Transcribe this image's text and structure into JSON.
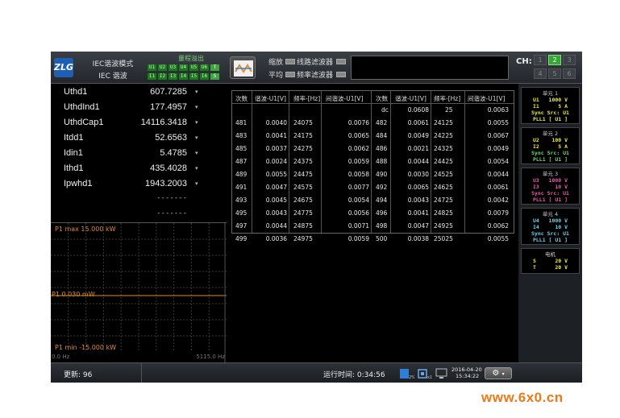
{
  "header": {
    "logo_text": "ZLG",
    "mode_line1": "IEC谐波模式",
    "mode_line2": "IEC 谐波",
    "range_title": "量程溢出",
    "range_row1": [
      "U1",
      "U2",
      "U3",
      "U4",
      "U5",
      "U6",
      "T"
    ],
    "range_row2": [
      "I1",
      "I2",
      "I3",
      "I4",
      "I5",
      "I6",
      "S"
    ],
    "opt_zoom": "缩放",
    "opt_line_filter": "线路滤波器",
    "opt_average": "平均",
    "opt_freq_filter": "频率滤波器",
    "ch_label": "CH:",
    "channels": [
      "1",
      "2",
      "3",
      "4",
      "5",
      "6"
    ],
    "active_channel": "2"
  },
  "measurements": [
    {
      "label": "Uthd1",
      "value": "607.7285"
    },
    {
      "label": "UthdInd1",
      "value": "177.4957"
    },
    {
      "label": "UthdCap1",
      "value": "14116.3418"
    },
    {
      "label": "Itdd1",
      "value": "52.6563"
    },
    {
      "label": "Idin1",
      "value": "5.4785"
    },
    {
      "label": "Ithd1",
      "value": "435.4028"
    },
    {
      "label": "Ipwhd1",
      "value": "1943.2003"
    },
    {
      "label": "",
      "value": "-------"
    },
    {
      "label": "",
      "value": "-------"
    }
  ],
  "harmonic_table": {
    "headers": [
      "次数",
      "谐波-U1[V]",
      "频率-[Hz]",
      "间谐波-U1[V]",
      "次数",
      "谐波-U1[V]",
      "频率-[Hz]",
      "间谐波-U1[V]"
    ],
    "rows": [
      [
        "",
        "",
        "",
        "",
        "dc",
        "0.0608",
        "25",
        "0.0063"
      ],
      [
        "481",
        "0.0040",
        "24075",
        "0.0076",
        "482",
        "0.0061",
        "24125",
        "0.0055"
      ],
      [
        "483",
        "0.0041",
        "24175",
        "0.0065",
        "484",
        "0.0049",
        "24225",
        "0.0067"
      ],
      [
        "485",
        "0.0037",
        "24275",
        "0.0062",
        "486",
        "0.0021",
        "24325",
        "0.0049"
      ],
      [
        "487",
        "0.0024",
        "24375",
        "0.0059",
        "488",
        "0.0044",
        "24425",
        "0.0054"
      ],
      [
        "489",
        "0.0055",
        "24475",
        "0.0058",
        "490",
        "0.0030",
        "24525",
        "0.0044"
      ],
      [
        "491",
        "0.0047",
        "24575",
        "0.0077",
        "492",
        "0.0065",
        "24625",
        "0.0061"
      ],
      [
        "493",
        "0.0045",
        "24675",
        "0.0054",
        "494",
        "0.0043",
        "24725",
        "0.0042"
      ],
      [
        "495",
        "0.0043",
        "24775",
        "0.0056",
        "496",
        "0.0041",
        "24825",
        "0.0079"
      ],
      [
        "497",
        "0.0044",
        "24875",
        "0.0071",
        "498",
        "0.0047",
        "24925",
        "0.0062"
      ],
      [
        "499",
        "0.0036",
        "24975",
        "0.0059",
        "500",
        "0.0038",
        "25025",
        "0.0055"
      ]
    ]
  },
  "waveform": {
    "max_label": "P1   max 15.000 kW",
    "mid_label": "P1 0.030 mW",
    "min_label": "P1   min -15.000 kW",
    "x_start": "0.0 Hz",
    "x_end": "5115.0 Hz",
    "trace_color": "#e08a2a"
  },
  "units": [
    {
      "title": "单元 1",
      "lines": [
        "U1   1000 V",
        "I1      5 A",
        "Sync Src: U1",
        "PLL1 [ U1 ]"
      ],
      "color": "#ffffff",
      "line_colors": [
        "#e9e94a",
        "#e9e94a",
        "#e9e94a",
        "#e9e94a"
      ]
    },
    {
      "title": "单元 2",
      "lines": [
        "U2    100 V",
        "I2      5 A",
        "Sync Src: U1",
        "PLL1 [ U1 ]"
      ],
      "line_colors": [
        "#e9e94a",
        "#e9e94a",
        "#6fd86f",
        "#6fd86f"
      ]
    },
    {
      "title": "单元 3",
      "lines": [
        "U3   1000 V",
        "I3     10 V",
        "Sync Src: U1",
        "PLL1 [ U1 ]"
      ],
      "line_colors": [
        "#e85aa8",
        "#e85aa8",
        "#e85aa8",
        "#e85aa8"
      ]
    },
    {
      "title": "单元 4",
      "lines": [
        "U4   1000 V",
        "I4     10 V",
        "Sync Src: U1",
        "PLL1 [ U1 ]"
      ],
      "line_colors": [
        "#6fd0e8",
        "#6fd0e8",
        "#6fd0e8",
        "#6fd0e8"
      ]
    },
    {
      "title": "电机",
      "lines": [
        "S      20 V",
        "T      20 V"
      ],
      "line_colors": [
        "#e9e94a",
        "#e9e94a"
      ]
    }
  ],
  "status": {
    "updates": "更新: 96",
    "run_time": "运行时间: 0:34:56",
    "date": "2016-04-20",
    "time": "15:34:22",
    "gear_icon": "gear-icon"
  },
  "watermark": "www.6x0.cn"
}
